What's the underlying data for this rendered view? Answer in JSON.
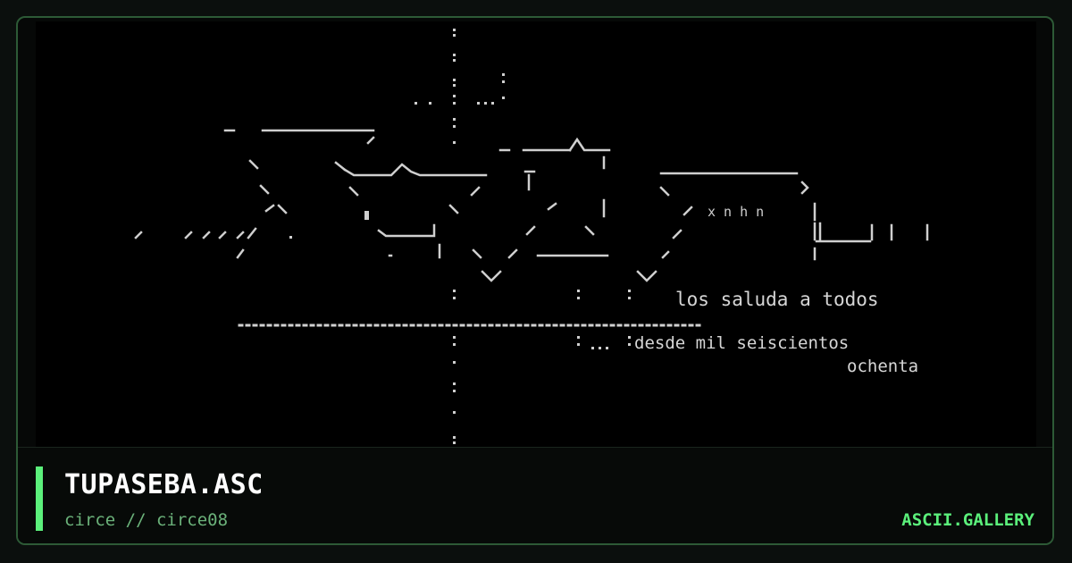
{
  "card": {
    "title": "TUPASEBA.ASC",
    "subtitle": "circe // circe08",
    "brand": "ASCII.GALLERY"
  },
  "art": {
    "line1": "los saluda a todos",
    "line2": "desde mil seiscientos",
    "line3": "ochenta"
  },
  "colors": {
    "accent": "#5bf07b",
    "subtitle": "#6bb27a",
    "art_text": "#d6d6d6",
    "border": "#2d5a36"
  }
}
